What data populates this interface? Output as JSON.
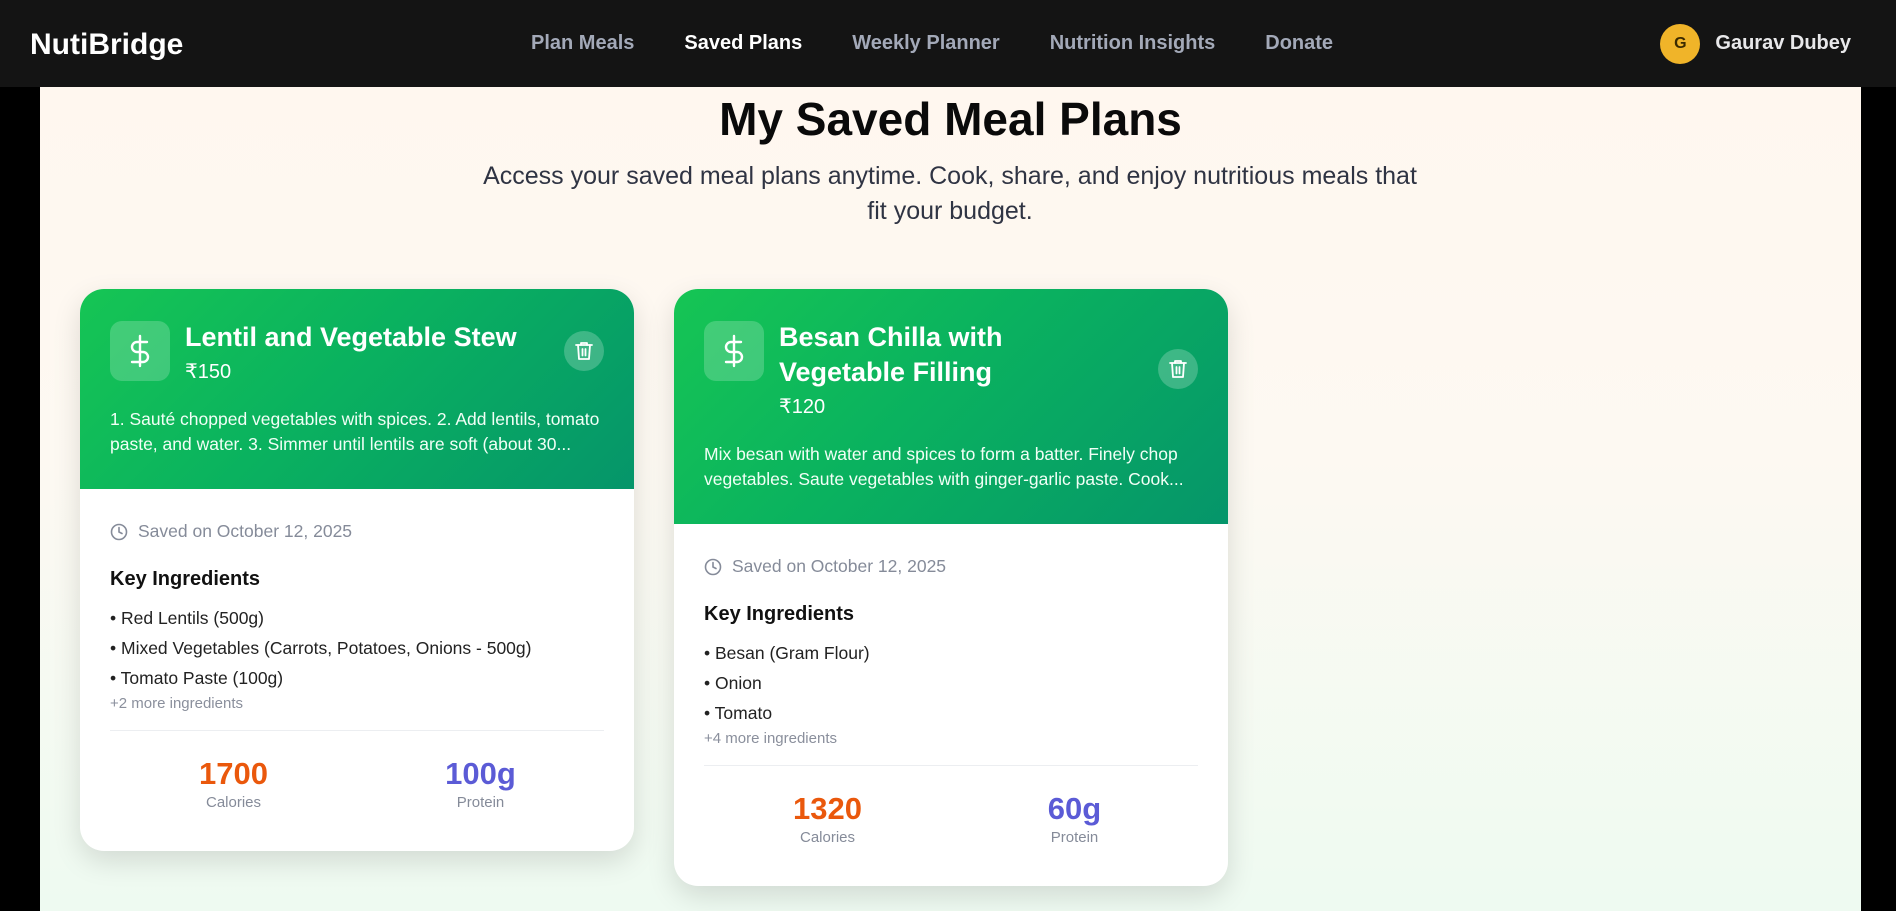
{
  "nav": {
    "brand": "NutiBridge",
    "links": [
      "Plan Meals",
      "Saved Plans",
      "Weekly Planner",
      "Nutrition Insights",
      "Donate"
    ],
    "active": "Saved Plans",
    "user": {
      "initial": "G",
      "name": "Gaurav Dubey"
    }
  },
  "page": {
    "title": "My Saved Meal Plans",
    "subtitle": "Access your saved meal plans anytime. Cook, share, and enjoy nutritious meals that fit your budget."
  },
  "cards": [
    {
      "title": "Lentil and Vegetable Stew",
      "price": "₹150",
      "description": "1. Sauté chopped vegetables with spices. 2. Add lentils, tomato paste, and water. 3. Simmer until lentils are soft (about 30...",
      "saved": "Saved on October 12, 2025",
      "ingredients_title": "Key Ingredients",
      "ingredients": [
        "• Red Lentils (500g)",
        "• Mixed Vegetables (Carrots, Potatoes, Onions - 500g)",
        "• Tomato Paste (100g)"
      ],
      "more": "+2 more ingredients",
      "calories": "1700",
      "calories_label": "Calories",
      "protein": "100g",
      "protein_label": "Protein"
    },
    {
      "title": "Besan Chilla with Vegetable Filling",
      "price": "₹120",
      "description": "Mix besan with water and spices to form a batter. Finely chop vegetables. Saute vegetables with ginger-garlic paste. Cook...",
      "saved": "Saved on October 12, 2025",
      "ingredients_title": "Key Ingredients",
      "ingredients": [
        "• Besan (Gram Flour)",
        "• Onion",
        "• Tomato"
      ],
      "more": "+4 more ingredients",
      "calories": "1320",
      "calories_label": "Calories",
      "protein": "60g",
      "protein_label": "Protein"
    }
  ],
  "icons": {
    "card_icon": "dollar-icon",
    "delete": "trash-icon",
    "saved": "clock-icon"
  },
  "colors": {
    "header_gradient_start": "#16c554",
    "header_gradient_end": "#05956a",
    "calories": "#ea580c",
    "protein": "#5b5bd6",
    "avatar": "#f0b429"
  }
}
